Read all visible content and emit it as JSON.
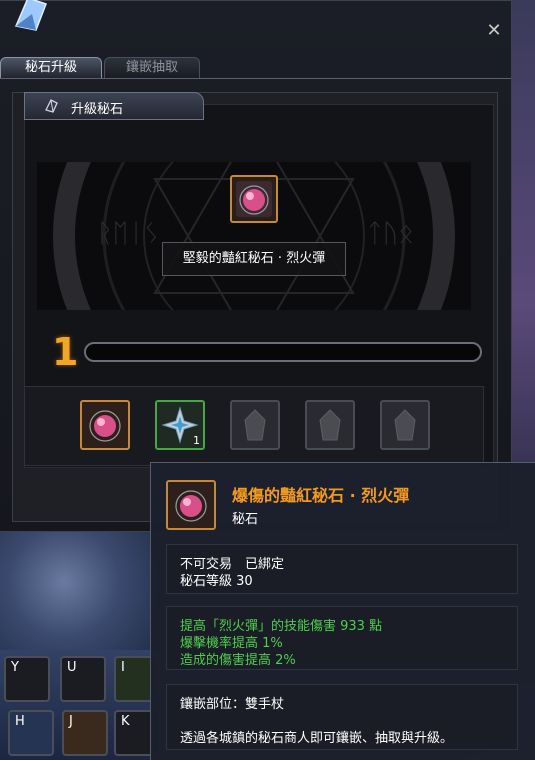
{
  "window": {
    "close_label": "✕"
  },
  "tabs": [
    {
      "label": "秘石升級",
      "active": true
    },
    {
      "label": "鑲嵌抽取",
      "active": false
    }
  ],
  "section": {
    "title": "升級秘石"
  },
  "target_gem": {
    "name": "堅毅的豔紅秘石 · 烈火彈",
    "icon": "red-gem-icon"
  },
  "level": {
    "value": "1",
    "progress": 0.0
  },
  "material_slots": [
    {
      "icon": "red-gem-icon",
      "border": "orange",
      "count": ""
    },
    {
      "icon": "star-stone-icon",
      "border": "green",
      "count": "1"
    },
    {
      "icon": "empty-slot-icon",
      "border": "gray",
      "count": ""
    },
    {
      "icon": "empty-slot-icon",
      "border": "gray",
      "count": ""
    },
    {
      "icon": "empty-slot-icon",
      "border": "gray",
      "count": ""
    }
  ],
  "tooltip": {
    "title": "爆傷的豔紅秘石 · 烈火彈",
    "subtitle": "秘石",
    "trade": "不可交易　已綁定",
    "level": "秘石等級 30",
    "effects": [
      "提高「烈火彈」的技能傷害 933 點",
      "爆擊機率提高 1%",
      "造成的傷害提高 2%"
    ],
    "socket": "鑲嵌部位：雙手杖",
    "note": "透過各城鎮的秘石商人即可鑲嵌、抽取與升級。"
  },
  "hotkeys": [
    {
      "key": "Y"
    },
    {
      "key": "U"
    },
    {
      "key": "I"
    },
    {
      "key": "H"
    },
    {
      "key": "J"
    },
    {
      "key": "K"
    }
  ],
  "colors": {
    "accent_orange": "#f39a1e",
    "effect_green": "#4fcf4f",
    "rare_border": "#c48a3a",
    "uncommon_border": "#49a54a"
  }
}
